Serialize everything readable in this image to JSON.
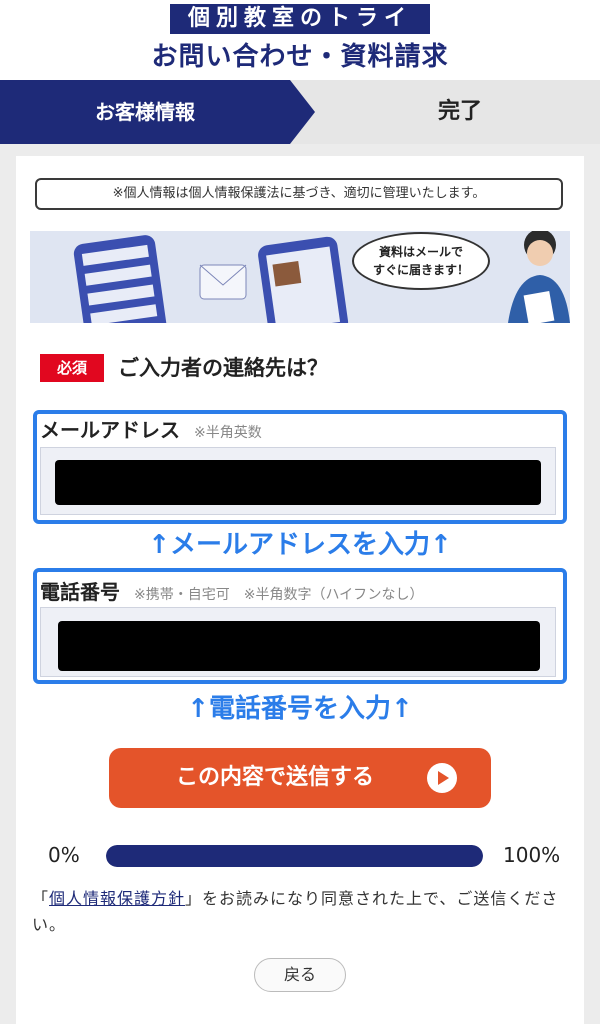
{
  "header": {
    "brand": "個別教室のトライ",
    "title": "お問い合わせ・資料請求"
  },
  "steps": {
    "active": "お客様情報",
    "next": "完了"
  },
  "privacy_note": "※個人情報は個人情報保護法に基づき、適切に管理いたします。",
  "banner": {
    "bubble_line1": "資料はメールで",
    "bubble_line2": "すぐに届きます！"
  },
  "form": {
    "required_badge": "必須",
    "question": "ご入力者の連絡先は？",
    "email": {
      "label": "メールアドレス",
      "hint": "※半角英数",
      "annotation": "↑メールアドレスを入力↑"
    },
    "phone": {
      "label": "電話番号",
      "hint": "※携帯・自宅可　※半角数字（ハイフンなし）",
      "annotation": "↑電話番号を入力↑"
    },
    "submit_label": "この内容で送信する"
  },
  "progress": {
    "min_label": "0%",
    "max_label": "100%",
    "value_percent": 100
  },
  "consent": {
    "prefix": "「",
    "link": "個人情報保護方針",
    "suffix": "」をお読みになり同意された上で、ご送信ください。"
  },
  "back_label": "戻る",
  "colors": {
    "brand_navy": "#1e2a78",
    "annotation_blue": "#2b7de9",
    "submit_orange": "#e4542a",
    "required_red": "#e1071f"
  }
}
